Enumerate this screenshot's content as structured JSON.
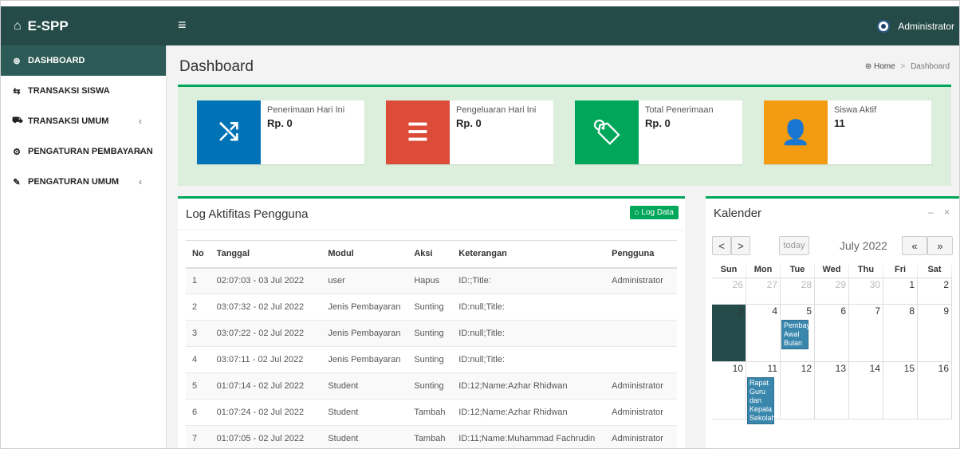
{
  "app": {
    "name": "E-SPP"
  },
  "header": {
    "user_name": "Administrator"
  },
  "sidebar": {
    "items": [
      {
        "label": "DASHBOARD",
        "icon": "dashboard-icon",
        "glyph": "⊛",
        "active": true,
        "chevron": ""
      },
      {
        "label": "TRANSAKSI SISWA",
        "icon": "exchange-icon",
        "glyph": "⇆",
        "active": false,
        "chevron": ""
      },
      {
        "label": "TRANSAKSI UMUM",
        "icon": "cart-icon",
        "glyph": "⛟",
        "active": false,
        "chevron": "‹"
      },
      {
        "label": "PENGATURAN PEMBAYARAN",
        "icon": "gear-icon",
        "glyph": "⚙",
        "active": false,
        "chevron": "‹"
      },
      {
        "label": "PENGATURAN UMUM",
        "icon": "wrench-icon",
        "glyph": "✎",
        "active": false,
        "chevron": "‹"
      }
    ]
  },
  "page": {
    "title": "Dashboard",
    "breadcrumb": {
      "home": "Home",
      "separator": ">",
      "current": "Dashboard"
    }
  },
  "stats": [
    {
      "label": "Penerimaan Hari Ini",
      "value": "Rp. 0",
      "color": "#0073b7",
      "icon": "shuffle-icon",
      "glyph": "⤭"
    },
    {
      "label": "Pengeluaran Hari Ini",
      "value": "Rp. 0",
      "color": "#dd4b39",
      "icon": "bars-icon",
      "glyph": "☰"
    },
    {
      "label": "Total Penerimaan",
      "value": "Rp. 0",
      "color": "#00a65a",
      "icon": "tags-icon",
      "glyph": "🏷"
    },
    {
      "label": "Siswa Aktif",
      "value": "11",
      "color": "#f39c12",
      "icon": "user-icon",
      "glyph": "👤"
    }
  ],
  "log": {
    "title": "Log Aktifitas Pengguna",
    "button": "Log Data",
    "columns": [
      "No",
      "Tanggal",
      "Modul",
      "Aksi",
      "Keterangan",
      "Pengguna"
    ],
    "rows": [
      [
        "1",
        "02:07:03 - 03 Jul 2022",
        "user",
        "Hapus",
        "ID:;Title:",
        "Administrator"
      ],
      [
        "2",
        "03:07:32 - 02 Jul 2022",
        "Jenis Pembayaran",
        "Sunting",
        "ID:null;Title:",
        ""
      ],
      [
        "3",
        "03:07:22 - 02 Jul 2022",
        "Jenis Pembayaran",
        "Sunting",
        "ID:null;Title:",
        ""
      ],
      [
        "4",
        "03:07:11 - 02 Jul 2022",
        "Jenis Pembayaran",
        "Sunting",
        "ID:null;Title:",
        ""
      ],
      [
        "5",
        "01:07:14 - 02 Jul 2022",
        "Student",
        "Sunting",
        "ID:12;Name:Azhar Rhidwan",
        "Administrator"
      ],
      [
        "6",
        "01:07:24 - 02 Jul 2022",
        "Student",
        "Tambah",
        "ID:12;Name:Azhar Rhidwan",
        "Administrator"
      ],
      [
        "7",
        "01:07:05 - 02 Jul 2022",
        "Student",
        "Tambah",
        "ID:11;Name:Muhammad Fachrudin",
        "Administrator"
      ]
    ]
  },
  "calendar": {
    "title": "Kalender",
    "prev": "<",
    "next": ">",
    "today": "today",
    "month": "July 2022",
    "prev_year": "«",
    "next_year": "»",
    "minimize": "–",
    "close": "×",
    "weekdays": [
      "Sun",
      "Mon",
      "Tue",
      "Wed",
      "Thu",
      "Fri",
      "Sat"
    ],
    "weeks": [
      [
        {
          "d": "26",
          "o": true
        },
        {
          "d": "27",
          "o": true
        },
        {
          "d": "28",
          "o": true
        },
        {
          "d": "29",
          "o": true
        },
        {
          "d": "30",
          "o": true
        },
        {
          "d": "1"
        },
        {
          "d": "2"
        }
      ],
      [
        {
          "d": "3",
          "today": true
        },
        {
          "d": "4"
        },
        {
          "d": "5",
          "event": "Pembay Awal Bulan"
        },
        {
          "d": "6"
        },
        {
          "d": "7"
        },
        {
          "d": "8"
        },
        {
          "d": "9"
        }
      ],
      [
        {
          "d": "10"
        },
        {
          "d": "11",
          "event": "Rapat Guru dan Kepala Sekolah"
        },
        {
          "d": "12"
        },
        {
          "d": "13"
        },
        {
          "d": "14"
        },
        {
          "d": "15"
        },
        {
          "d": "16"
        }
      ]
    ]
  }
}
